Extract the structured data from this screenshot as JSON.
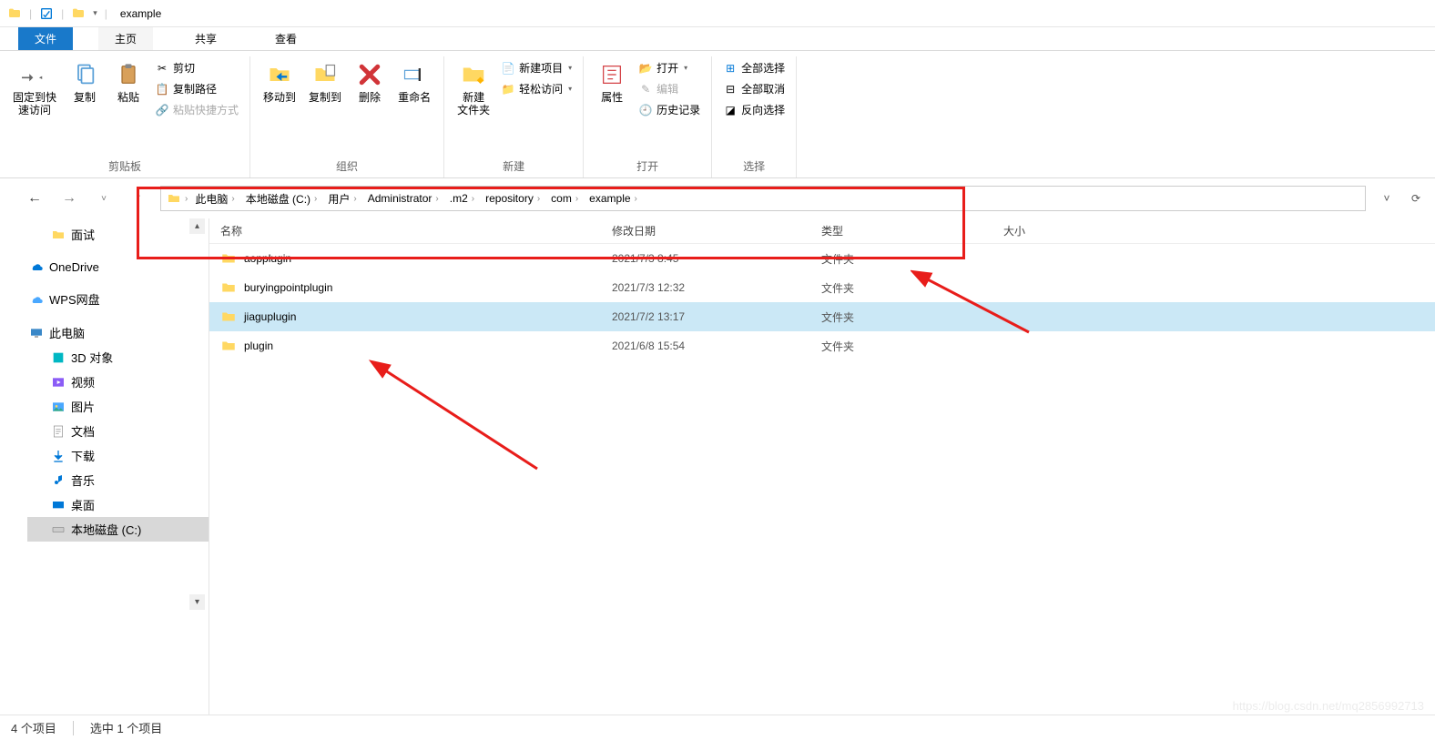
{
  "window": {
    "title": "example"
  },
  "tabs": {
    "file": "文件",
    "home": "主页",
    "share": "共享",
    "view": "查看"
  },
  "ribbon": {
    "pin_label": "固定到快\n速访问",
    "copy_label": "复制",
    "paste_label": "粘贴",
    "cut": "剪切",
    "copy_path": "复制路径",
    "paste_shortcut": "粘贴快捷方式",
    "group_clipboard": "剪贴板",
    "move_to": "移动到",
    "copy_to": "复制到",
    "delete": "删除",
    "rename": "重命名",
    "group_organize": "组织",
    "new_folder": "新建\n文件夹",
    "new_item": "新建项目",
    "easy_access": "轻松访问",
    "group_new": "新建",
    "properties": "属性",
    "open": "打开",
    "edit": "编辑",
    "history": "历史记录",
    "group_open": "打开",
    "select_all": "全部选择",
    "select_none": "全部取消",
    "invert_sel": "反向选择",
    "group_select": "选择"
  },
  "breadcrumb": {
    "items": [
      "此电脑",
      "本地磁盘 (C:)",
      "用户",
      "Administrator",
      ".m2",
      "repository",
      "com",
      "example"
    ]
  },
  "tree": {
    "items": [
      "面试",
      "OneDrive",
      "WPS网盘",
      "此电脑",
      "3D 对象",
      "视频",
      "图片",
      "文档",
      "下载",
      "音乐",
      "桌面",
      "本地磁盘 (C:)"
    ]
  },
  "columns": {
    "name": "名称",
    "date": "修改日期",
    "type": "类型",
    "size": "大小"
  },
  "rows": [
    {
      "name": "aopplugin",
      "date": "2021/7/3 8:45",
      "type": "文件夹",
      "selected": false
    },
    {
      "name": "buryingpointplugin",
      "date": "2021/7/3 12:32",
      "type": "文件夹",
      "selected": false
    },
    {
      "name": "jiaguplugin",
      "date": "2021/7/2 13:17",
      "type": "文件夹",
      "selected": true
    },
    {
      "name": "plugin",
      "date": "2021/6/8 15:54",
      "type": "文件夹",
      "selected": false
    }
  ],
  "status": {
    "count": "4 个项目",
    "selected": "选中 1 个项目"
  },
  "watermark": "https://blog.csdn.net/mq2856992713"
}
